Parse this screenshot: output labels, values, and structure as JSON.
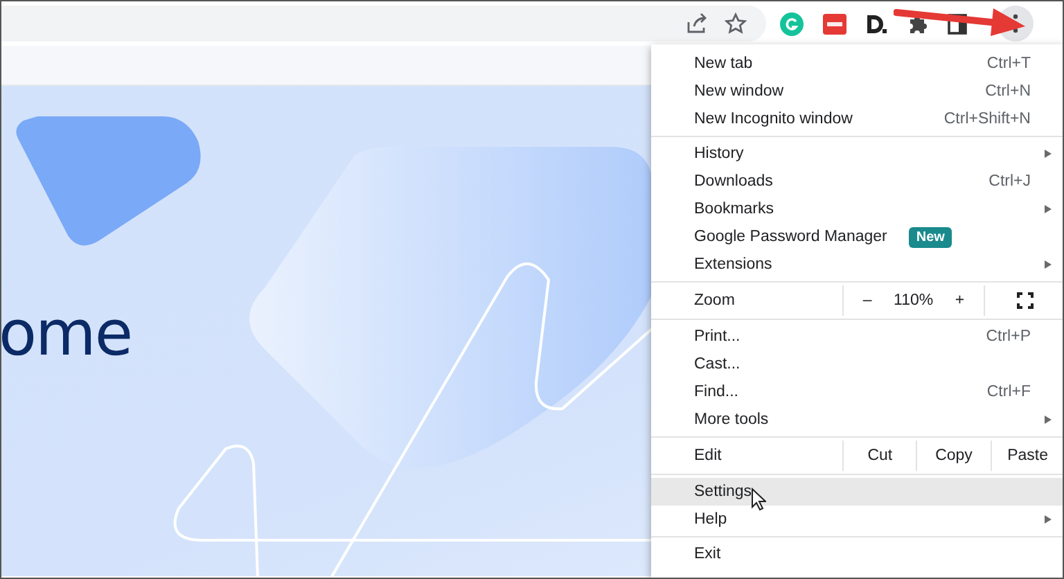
{
  "page": {
    "heading": "ome"
  },
  "menu": {
    "sections": [
      {
        "items": [
          {
            "kind": "item",
            "label": "New tab",
            "shortcut": "Ctrl+T",
            "submenu": false,
            "highlighted": false
          },
          {
            "kind": "item",
            "label": "New window",
            "shortcut": "Ctrl+N",
            "submenu": false,
            "highlighted": false
          },
          {
            "kind": "item",
            "label": "New Incognito window",
            "shortcut": "Ctrl+Shift+N",
            "submenu": false,
            "highlighted": false
          }
        ]
      },
      {
        "items": [
          {
            "kind": "item",
            "label": "History",
            "submenu": true,
            "highlighted": false
          },
          {
            "kind": "item",
            "label": "Downloads",
            "shortcut": "Ctrl+J",
            "submenu": false,
            "highlighted": false
          },
          {
            "kind": "item",
            "label": "Bookmarks",
            "submenu": true,
            "highlighted": false
          },
          {
            "kind": "item",
            "label": "Google Password Manager",
            "badge": "New",
            "submenu": false,
            "highlighted": false
          },
          {
            "kind": "item",
            "label": "Extensions",
            "submenu": true,
            "highlighted": false
          }
        ]
      },
      {
        "items": [
          {
            "kind": "zoom",
            "label": "Zoom",
            "minus": "–",
            "value": "110%",
            "plus": "+"
          }
        ]
      },
      {
        "items": [
          {
            "kind": "item",
            "label": "Print...",
            "shortcut": "Ctrl+P",
            "submenu": false,
            "highlighted": false
          },
          {
            "kind": "item",
            "label": "Cast...",
            "submenu": false,
            "highlighted": false
          },
          {
            "kind": "item",
            "label": "Find...",
            "shortcut": "Ctrl+F",
            "submenu": false,
            "highlighted": false
          },
          {
            "kind": "item",
            "label": "More tools",
            "submenu": true,
            "highlighted": false
          }
        ]
      },
      {
        "items": [
          {
            "kind": "edit",
            "label": "Edit",
            "actions": [
              "Cut",
              "Copy",
              "Paste"
            ]
          }
        ]
      },
      {
        "items": [
          {
            "kind": "item",
            "label": "Settings",
            "submenu": false,
            "highlighted": true
          },
          {
            "kind": "item",
            "label": "Help",
            "submenu": true,
            "highlighted": false
          }
        ]
      },
      {
        "items": [
          {
            "kind": "item",
            "label": "Exit",
            "submenu": false,
            "highlighted": false
          }
        ]
      }
    ]
  }
}
